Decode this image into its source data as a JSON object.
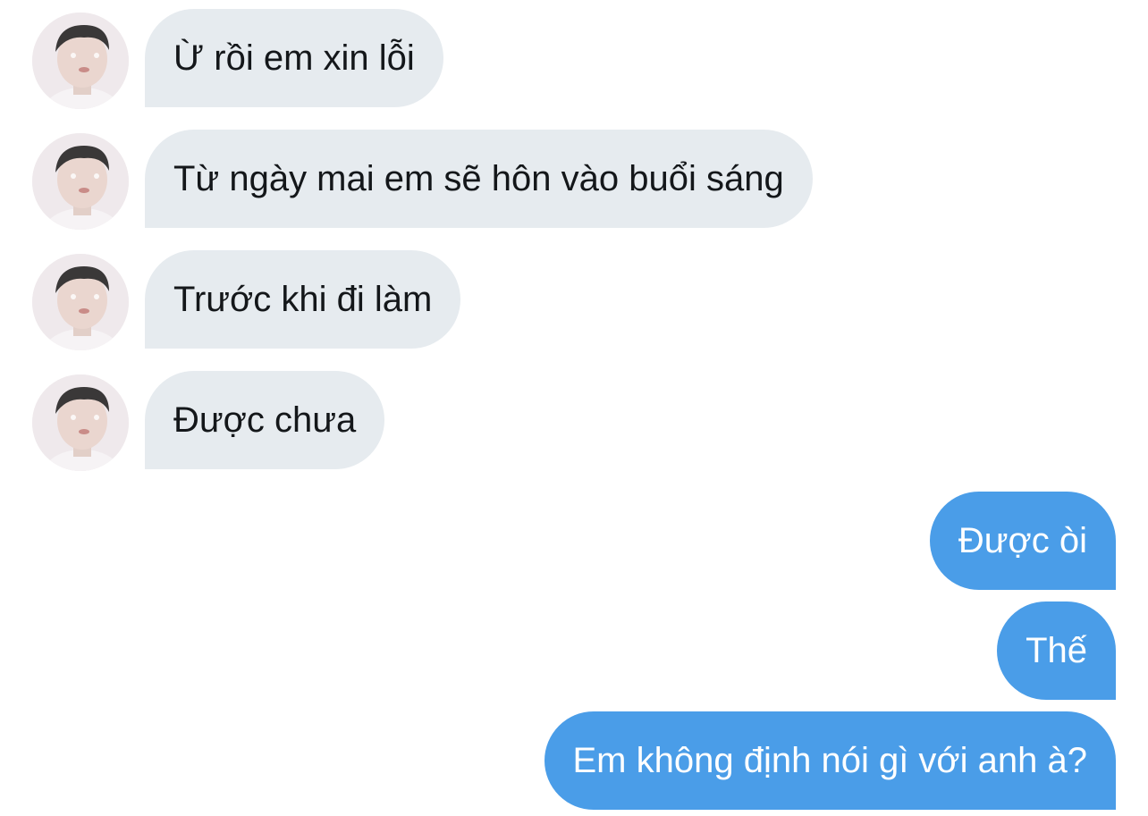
{
  "conversation": {
    "incoming": [
      {
        "text": "Ừ rồi em xin lỗi"
      },
      {
        "text": "Từ ngày mai em sẽ hôn vào buổi sáng"
      },
      {
        "text": "Trước khi đi làm"
      },
      {
        "text": "Được chưa"
      }
    ],
    "outgoing": [
      {
        "text": "Được òi"
      },
      {
        "text": "Thế"
      },
      {
        "text": "Em không định nói gì với anh à?"
      }
    ]
  },
  "colors": {
    "incoming_bubble": "#e6ebef",
    "outgoing_bubble": "#4a9de8",
    "incoming_text": "#14171a",
    "outgoing_text": "#ffffff"
  },
  "icons": {
    "avatar": "contact-avatar-photo"
  }
}
